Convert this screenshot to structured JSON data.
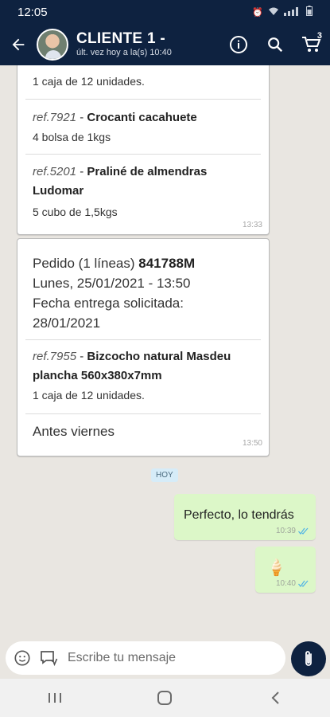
{
  "statusbar": {
    "time": "12:05"
  },
  "header": {
    "title": "CLIENTE 1 -",
    "subtitle": "últ. vez hoy a la(s) 10:40",
    "cart_count": "3"
  },
  "messages": {
    "card1": {
      "partial_text": "1 caja de 12 unidades.",
      "items": [
        {
          "ref": "ref.7921",
          "name": "Crocanti cacahuete",
          "qty": "4 bolsa de 1kgs"
        },
        {
          "ref": "ref.5201",
          "name": "Praliné de almendras Ludomar",
          "qty": "5 cubo de 1,5kgs"
        }
      ],
      "time": "13:33"
    },
    "card2": {
      "order_prefix": "Pedido (1 líneas)",
      "order_number": "841788M",
      "date": "Lunes, 25/01/2021 - 13:50",
      "delivery_label": "Fecha entrega solicitada:",
      "delivery_date": "28/01/2021",
      "item": {
        "ref": "ref.7955",
        "name": "Bizcocho natural Masdeu plancha 560x380x7mm",
        "qty": "1 caja de 12 unidades."
      },
      "note": "Antes viernes",
      "time": "13:50"
    },
    "day_chip": "HOY",
    "outgoing": [
      {
        "text": "Perfecto, lo tendrás",
        "time": "10:39"
      },
      {
        "text": "🍦",
        "time": "10:40"
      }
    ]
  },
  "composer": {
    "placeholder": "Escribe tu mensaje"
  },
  "colors": {
    "header": "#0e2240",
    "outgoing_bubble": "#dcf7c8",
    "read_ticks": "#4fb3e6"
  }
}
